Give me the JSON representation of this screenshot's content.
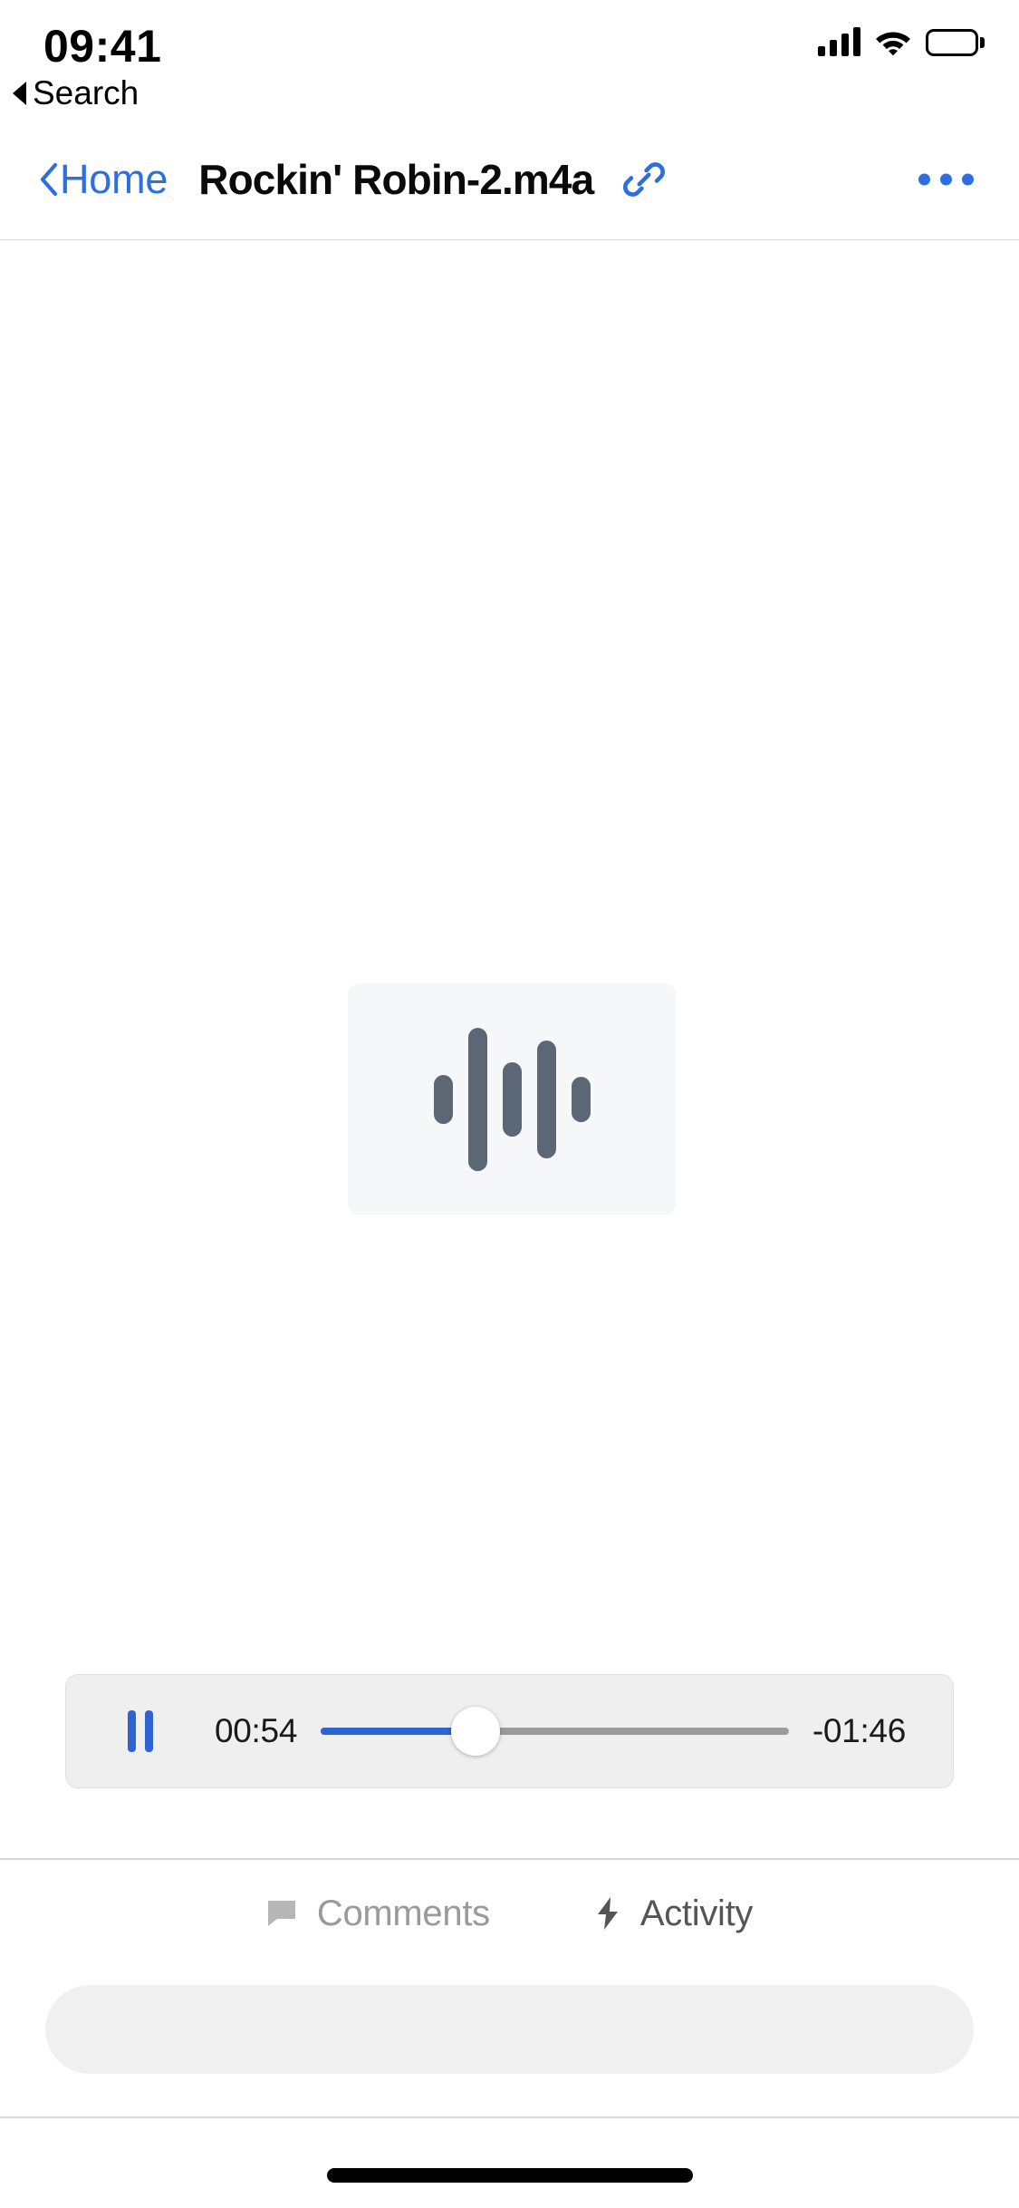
{
  "status_bar": {
    "time": "09:41",
    "back_label": "Search",
    "cellular_icon": "signal-bars-icon",
    "wifi_icon": "wifi-icon",
    "battery_icon": "battery-full-icon"
  },
  "nav_bar": {
    "back_label": "Home",
    "back_chevron_icon": "chevron-left-icon",
    "title": "Rockin' Robin-2.m4a",
    "link_icon": "link-chain-icon",
    "more_icon": "more-horizontal-icon",
    "accent_color": "#2d6fde"
  },
  "preview": {
    "thumbnail_icon": "audio-waveform-icon",
    "waveform_bar_heights": [
      54,
      158,
      82,
      130,
      50
    ],
    "thumbnail_bg": "#f6f7f9",
    "waveform_color": "#5c6775"
  },
  "player": {
    "state": "playing",
    "play_pause_icon": "pause-icon",
    "time_elapsed": "00:54",
    "time_remaining": "-01:46",
    "progress_percent": 33,
    "fill_color": "#2d63d2",
    "rail_color": "#9b9b9b"
  },
  "tabs": [
    {
      "label": "Comments",
      "icon": "comment-bubble-icon",
      "active": false
    },
    {
      "label": "Activity",
      "icon": "lightning-bolt-icon",
      "active": true
    }
  ],
  "composer": {
    "value": "",
    "placeholder": ""
  },
  "home_indicator": {
    "icon": "home-indicator-bar"
  }
}
